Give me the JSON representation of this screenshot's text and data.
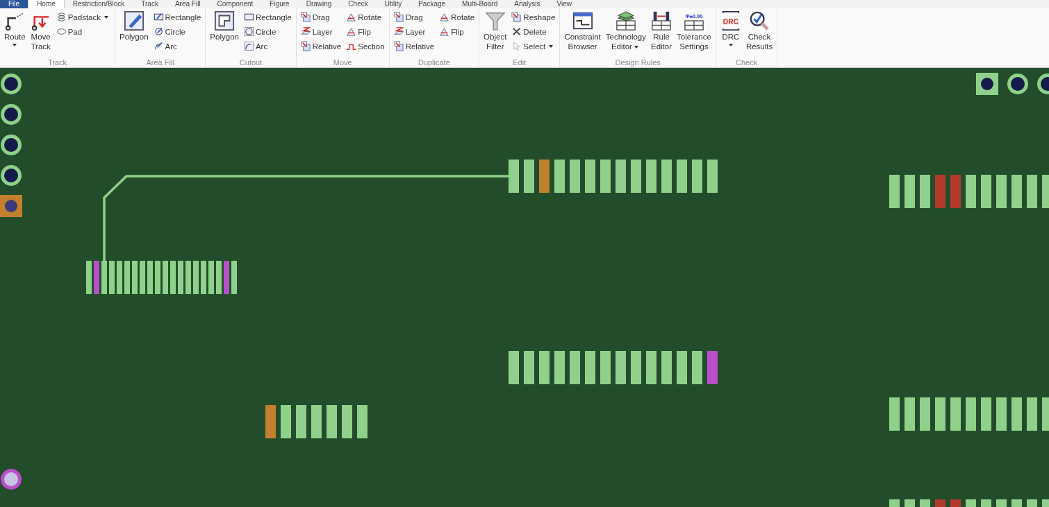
{
  "tabs": [
    {
      "label": "File",
      "kind": "app",
      "selected": false
    },
    {
      "label": "Home",
      "kind": "tab",
      "selected": true
    },
    {
      "label": "Restriction/Block",
      "kind": "tab",
      "selected": false
    },
    {
      "label": "Track",
      "kind": "tab",
      "selected": false
    },
    {
      "label": "Area Fill",
      "kind": "tab",
      "selected": false
    },
    {
      "label": "Component",
      "kind": "tab",
      "selected": false
    },
    {
      "label": "Figure",
      "kind": "tab",
      "selected": false
    },
    {
      "label": "Drawing",
      "kind": "tab",
      "selected": false
    },
    {
      "label": "Check",
      "kind": "tab",
      "selected": false
    },
    {
      "label": "Utility",
      "kind": "tab",
      "selected": false
    },
    {
      "label": "Package",
      "kind": "tab",
      "selected": false
    },
    {
      "label": "Multi-Board",
      "kind": "tab",
      "selected": false
    },
    {
      "label": "Analysis",
      "kind": "tab",
      "selected": false
    },
    {
      "label": "View",
      "kind": "tab",
      "selected": false
    }
  ],
  "ribbon_groups": [
    {
      "label": "Track",
      "columns": [
        {
          "kind": "large",
          "label": "Route",
          "dropdown": true
        },
        {
          "kind": "large",
          "label": "Move Track",
          "dropdown": false
        },
        {
          "kind": "stack",
          "items": [
            {
              "label": "Padstack",
              "dropdown": true
            },
            {
              "label": "Pad",
              "dropdown": false
            }
          ]
        }
      ]
    },
    {
      "label": "Area Fill",
      "columns": [
        {
          "kind": "large",
          "label": "Polygon",
          "dropdown": false
        },
        {
          "kind": "stack",
          "items": [
            {
              "label": "Rectangle",
              "dropdown": false
            },
            {
              "label": "Circle",
              "dropdown": false
            },
            {
              "label": "Arc",
              "dropdown": false
            }
          ]
        }
      ]
    },
    {
      "label": "Cutout",
      "columns": [
        {
          "kind": "large",
          "label": "Polygon",
          "dropdown": false
        },
        {
          "kind": "stack",
          "items": [
            {
              "label": "Rectangle",
              "dropdown": false
            },
            {
              "label": "Circle",
              "dropdown": false
            },
            {
              "label": "Arc",
              "dropdown": false
            }
          ]
        }
      ]
    },
    {
      "label": "Move",
      "columns": [
        {
          "kind": "stack",
          "items": [
            {
              "label": "Drag",
              "dropdown": false
            },
            {
              "label": "Layer",
              "dropdown": false
            },
            {
              "label": "Relative",
              "dropdown": false
            }
          ]
        },
        {
          "kind": "stack",
          "items": [
            {
              "label": "Rotate",
              "dropdown": false
            },
            {
              "label": "Flip",
              "dropdown": false
            },
            {
              "label": "Section",
              "dropdown": false
            }
          ]
        }
      ]
    },
    {
      "label": "Duplicate",
      "columns": [
        {
          "kind": "stack",
          "items": [
            {
              "label": "Drag",
              "dropdown": false
            },
            {
              "label": "Layer",
              "dropdown": false
            },
            {
              "label": "Relative",
              "dropdown": false
            }
          ]
        },
        {
          "kind": "stack",
          "items": [
            {
              "label": "Rotate",
              "dropdown": false
            },
            {
              "label": "Flip",
              "dropdown": false
            }
          ]
        }
      ]
    },
    {
      "label": "Edit",
      "columns": [
        {
          "kind": "large",
          "label": "Object Filter",
          "dropdown": false
        },
        {
          "kind": "stack",
          "items": [
            {
              "label": "Reshape",
              "dropdown": false
            },
            {
              "label": "Delete",
              "dropdown": false
            },
            {
              "label": "Select",
              "dropdown": true
            }
          ]
        }
      ]
    },
    {
      "label": "Design Rules",
      "columns": [
        {
          "kind": "large",
          "label": "Constraint Browser",
          "dropdown": false
        },
        {
          "kind": "large",
          "label": "Technology Editor",
          "dropdown": true
        },
        {
          "kind": "large",
          "label": "Rule Editor",
          "dropdown": false
        },
        {
          "kind": "large",
          "label": "Tolerance Settings",
          "dropdown": false,
          "icon_text": "Φ±0.00"
        }
      ]
    },
    {
      "label": "Check",
      "columns": [
        {
          "kind": "large",
          "label": "DRC",
          "dropdown": true,
          "icon_text": "DRC"
        },
        {
          "kind": "large",
          "label": "Check Results",
          "dropdown": false
        }
      ]
    }
  ],
  "vias": [
    {
      "kind": "round",
      "color": "#8fd18a"
    },
    {
      "kind": "round",
      "color": "#8fd18a"
    },
    {
      "kind": "round",
      "color": "#8fd18a"
    },
    {
      "kind": "round",
      "color": "#8fd18a"
    },
    {
      "kind": "square",
      "color": "#c27f2c"
    },
    {
      "kind": "round",
      "color": "#b94fc9"
    },
    {
      "kind": "square",
      "color": "#8fd18a"
    },
    {
      "kind": "round",
      "color": "#8fd18a"
    },
    {
      "kind": "round",
      "color": "#8fd18a"
    }
  ],
  "components": [
    {
      "pads": [
        {
          "color": "#8fd18a"
        },
        {
          "color": "#b94fc9"
        },
        {
          "color": "#8fd18a"
        },
        {
          "color": "#8fd18a"
        },
        {
          "color": "#8fd18a"
        },
        {
          "color": "#8fd18a"
        },
        {
          "color": "#8fd18a"
        },
        {
          "color": "#8fd18a"
        },
        {
          "color": "#8fd18a"
        },
        {
          "color": "#8fd18a"
        },
        {
          "color": "#8fd18a"
        },
        {
          "color": "#8fd18a"
        },
        {
          "color": "#8fd18a"
        },
        {
          "color": "#8fd18a"
        },
        {
          "color": "#8fd18a"
        },
        {
          "color": "#8fd18a"
        },
        {
          "color": "#8fd18a"
        },
        {
          "color": "#8fd18a"
        },
        {
          "color": "#b94fc9"
        },
        {
          "color": "#8fd18a"
        }
      ]
    },
    {
      "pads": [
        {
          "color": "#8fd18a"
        },
        {
          "color": "#8fd18a"
        },
        {
          "color": "#c27f2c"
        },
        {
          "color": "#8fd18a"
        },
        {
          "color": "#8fd18a"
        },
        {
          "color": "#8fd18a"
        },
        {
          "color": "#8fd18a"
        },
        {
          "color": "#8fd18a"
        },
        {
          "color": "#8fd18a"
        },
        {
          "color": "#8fd18a"
        },
        {
          "color": "#8fd18a"
        },
        {
          "color": "#8fd18a"
        },
        {
          "color": "#8fd18a"
        },
        {
          "color": "#8fd18a"
        }
      ]
    },
    {
      "pads": [
        {
          "color": "#8fd18a"
        },
        {
          "color": "#8fd18a"
        },
        {
          "color": "#8fd18a"
        },
        {
          "color": "#b23a2a"
        },
        {
          "color": "#b23a2a"
        },
        {
          "color": "#8fd18a"
        },
        {
          "color": "#8fd18a"
        },
        {
          "color": "#8fd18a"
        },
        {
          "color": "#8fd18a"
        },
        {
          "color": "#8fd18a"
        },
        {
          "color": "#8fd18a"
        }
      ]
    },
    {
      "pads": [
        {
          "color": "#8fd18a"
        },
        {
          "color": "#8fd18a"
        },
        {
          "color": "#8fd18a"
        },
        {
          "color": "#8fd18a"
        },
        {
          "color": "#8fd18a"
        },
        {
          "color": "#8fd18a"
        },
        {
          "color": "#8fd18a"
        },
        {
          "color": "#8fd18a"
        },
        {
          "color": "#8fd18a"
        },
        {
          "color": "#8fd18a"
        },
        {
          "color": "#8fd18a"
        },
        {
          "color": "#8fd18a"
        },
        {
          "color": "#8fd18a"
        },
        {
          "color": "#b94fc9"
        }
      ]
    },
    {
      "pads": [
        {
          "color": "#c27f2c"
        },
        {
          "color": "#8fd18a"
        },
        {
          "color": "#8fd18a"
        },
        {
          "color": "#8fd18a"
        },
        {
          "color": "#8fd18a"
        },
        {
          "color": "#8fd18a"
        },
        {
          "color": "#8fd18a"
        }
      ]
    },
    {
      "pads": [
        {
          "color": "#8fd18a"
        },
        {
          "color": "#8fd18a"
        },
        {
          "color": "#8fd18a"
        },
        {
          "color": "#8fd18a"
        },
        {
          "color": "#8fd18a"
        },
        {
          "color": "#8fd18a"
        },
        {
          "color": "#8fd18a"
        },
        {
          "color": "#8fd18a"
        },
        {
          "color": "#8fd18a"
        },
        {
          "color": "#8fd18a"
        },
        {
          "color": "#8fd18a"
        }
      ]
    },
    {
      "pads": [
        {
          "color": "#8fd18a"
        },
        {
          "color": "#8fd18a"
        },
        {
          "color": "#8fd18a"
        },
        {
          "color": "#b23a2a"
        },
        {
          "color": "#b23a2a"
        },
        {
          "color": "#8fd18a"
        },
        {
          "color": "#8fd18a"
        },
        {
          "color": "#8fd18a"
        },
        {
          "color": "#8fd18a"
        },
        {
          "color": "#8fd18a"
        },
        {
          "color": "#8fd18a"
        }
      ]
    }
  ]
}
